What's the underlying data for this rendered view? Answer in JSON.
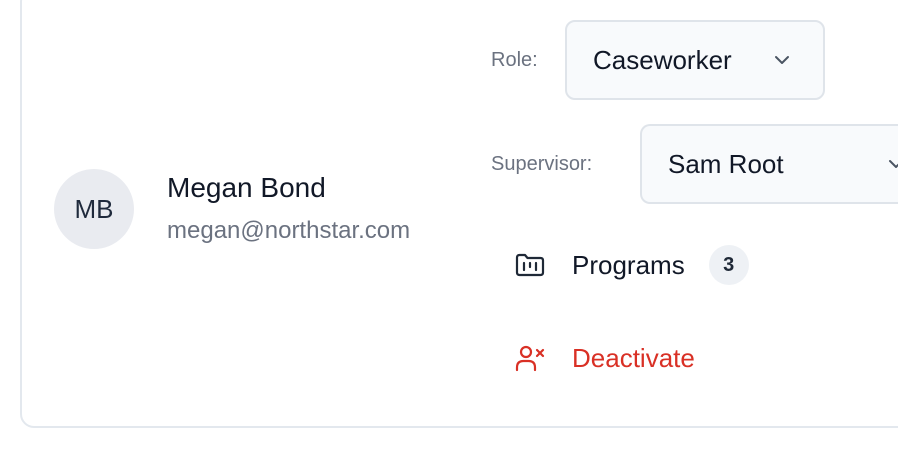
{
  "user": {
    "initials": "MB",
    "name": "Megan Bond",
    "email": "megan@northstar.com"
  },
  "role": {
    "label": "Role:",
    "value": "Caseworker",
    "icon": "chevron-down-icon"
  },
  "supervisor": {
    "label": "Supervisor:",
    "value": "Sam Root",
    "icon": "chevron-down-icon"
  },
  "programs": {
    "label": "Programs",
    "count": "3",
    "icon": "folder-kanban-icon"
  },
  "deactivate": {
    "label": "Deactivate",
    "icon": "user-x-icon",
    "color": "#d93025"
  },
  "colors": {
    "text_primary": "#111827",
    "text_muted": "#6b7280",
    "border": "#dfe4ea",
    "danger": "#d93025"
  }
}
